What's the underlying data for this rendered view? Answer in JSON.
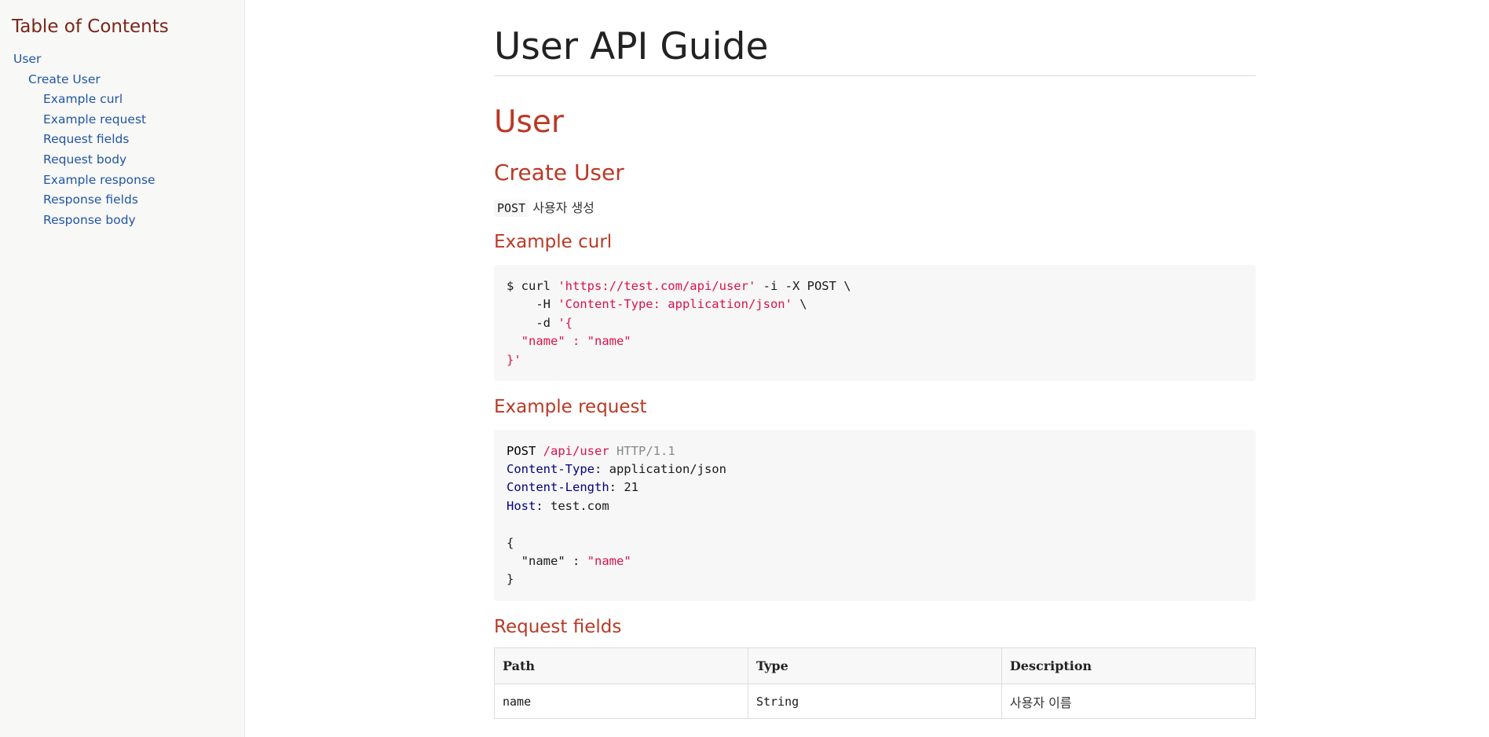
{
  "toc": {
    "title": "Table of Contents",
    "items": [
      {
        "label": "User"
      },
      {
        "label": "Create User"
      },
      {
        "label": "Example curl"
      },
      {
        "label": "Example request"
      },
      {
        "label": "Request fields"
      },
      {
        "label": "Request body"
      },
      {
        "label": "Example response"
      },
      {
        "label": "Response fields"
      },
      {
        "label": "Response body"
      }
    ]
  },
  "doc": {
    "title": "User API Guide",
    "section": "User",
    "subsection": "Create User",
    "method": "POST",
    "method_desc": "사용자 생성",
    "curl_heading": "Example curl",
    "curl": {
      "l1_cmd": "$ curl ",
      "l1_url": "'https://test.com/api/user'",
      "l1_rest": " -i -X POST \\",
      "l2_pre": "    -H ",
      "l2_str": "'Content-Type: application/json'",
      "l2_rest": " \\",
      "l3_pre": "    -d ",
      "l3_str": "'{",
      "l4": "  \"name\" : \"name\"",
      "l5": "}'"
    },
    "request_heading": "Example request",
    "request": {
      "method": "POST",
      "path": "/api/user",
      "protocol": "HTTP/1.1",
      "h1_name": "Content-Type",
      "h1_val": ": application/json",
      "h2_name": "Content-Length",
      "h2_val": ": 21",
      "h3_name": "Host",
      "h3_val": ": test.com",
      "b1": "{",
      "b2_key": "  \"name\" : ",
      "b2_val": "\"name\"",
      "b3": "}"
    },
    "fields_heading": "Request fields",
    "fields_table": {
      "headers": [
        "Path",
        "Type",
        "Description"
      ],
      "rows": [
        [
          "name",
          "String",
          "사용자 이름"
        ]
      ]
    }
  }
}
